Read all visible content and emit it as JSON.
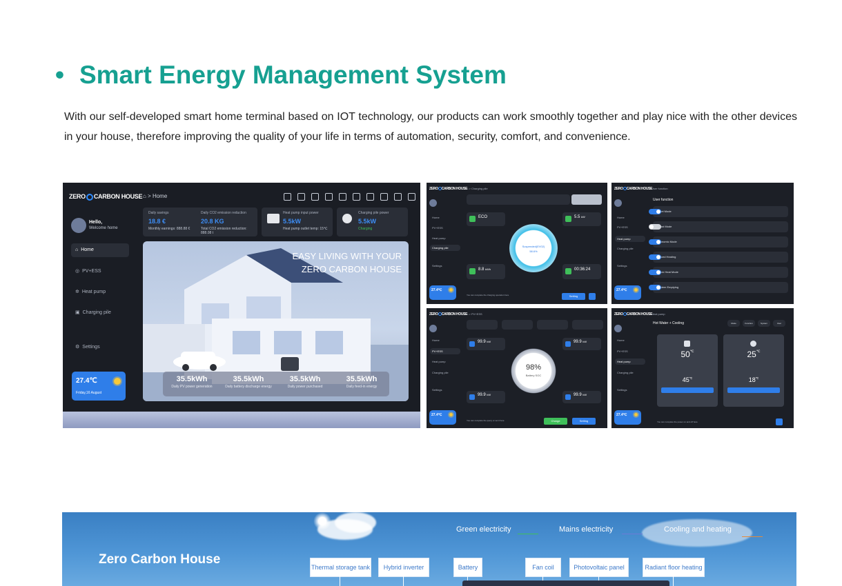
{
  "header": {
    "bullet": "•",
    "title": "Smart Energy Management System",
    "description": "With our self-developed smart home terminal based on IOT technology, our products can work smoothly together and play nice with the other devices in your house, therefore improving the quality of your life in terms of automation, security, comfort, and convenience."
  },
  "brand": {
    "logo_left": "ZERO",
    "logo_right": "CARBON HOUSE"
  },
  "main_screen": {
    "breadcrumb": "⌂ > Home",
    "greeting": "Hello,",
    "welcome": "Welcome home",
    "sidebar": [
      "Home",
      "PV+ESS",
      "Heat pump",
      "Charging pile",
      "Settings"
    ],
    "cards": [
      {
        "label": "Daily savings",
        "value": "18.8 €",
        "sub": "Monthly earnings: 888.88 €"
      },
      {
        "label": "Daily CO2 emission reduction",
        "value": "20.8 KG",
        "sub": "Total CO2 emission reduction: 888.08 t"
      },
      {
        "label": "Heat pump input power",
        "value": "5.5kW",
        "sub": "Heat pump outlet temp: 15℃"
      },
      {
        "label": "Charging pile power",
        "value": "5.5kW",
        "sub": "Charging"
      }
    ],
    "headline_1": "EASY LIVING WITH YOUR",
    "headline_2": "ZERO CARBON HOUSE",
    "stats": [
      {
        "value": "35.5kWh",
        "label": "Daily PV power generation"
      },
      {
        "value": "35.5kWh",
        "label": "Daily battery discharge energy"
      },
      {
        "value": "35.5kWh",
        "label": "Daily power purchased"
      },
      {
        "value": "35.5kWh",
        "label": "Daily feed-in energy"
      }
    ],
    "weather_temp": "27.4℃",
    "weather_date": "Friday,16 August"
  },
  "screen_charging": {
    "breadcrumb": "⌂ > Charging pile",
    "mode": "ECO",
    "power": "5.5",
    "power_unit": "kW",
    "energy": "8.8",
    "energy_unit": "kWh",
    "time": "00:36:24",
    "gauge_label": "Suspended(EV02)",
    "gauge_value": "58.6%",
    "button": "Setting",
    "footer": "You can complete the charging operation here"
  },
  "screen_functions": {
    "breadcrumb": "User function",
    "title": "User function",
    "rows": [
      {
        "label": "Quiet Mode",
        "on": true
      },
      {
        "label": "Boost Mode",
        "on": false
      },
      {
        "label": "Economic Mode",
        "on": true
      },
      {
        "label": "Forced Heating",
        "on": true
      },
      {
        "label": "Quick Heat Mode",
        "on": true
      },
      {
        "label": "System Emptying",
        "on": true
      }
    ]
  },
  "screen_pvess": {
    "breadcrumb": "⌂ > PV+ESS",
    "tiles": [
      "99.9",
      "99.9",
      "99.9",
      "99.9"
    ],
    "tile_unit": "kW",
    "soc": "98%",
    "soc_label": "Battery SOC",
    "btn_left": "Charge",
    "btn_right": "Setting",
    "footer": "You can complete the query or set it here"
  },
  "screen_heatpump": {
    "breadcrumb": "Heat pump",
    "mode_title": "Hot Water + Cooling",
    "tabs": [
      "Mode",
      "Function",
      "System",
      "User"
    ],
    "left_temp": "50",
    "right_temp": "25",
    "left_set": "45",
    "right_set": "18",
    "unit": "℃",
    "footer": "You can complete the power on and off here"
  },
  "banner": {
    "title": "Zero Carbon House",
    "legend": [
      {
        "label": "Green electricity",
        "color": "#3fbf5a"
      },
      {
        "label": "Mains electricity",
        "color": "#6c7bd6"
      },
      {
        "label": "Cooling and heating",
        "color": "#e58a3a"
      }
    ],
    "tags": [
      "Thermal storage tank",
      "Hybrid inverter",
      "Battery",
      "Fan coil",
      "Photovoltaic panel",
      "Radiant floor heating"
    ]
  }
}
